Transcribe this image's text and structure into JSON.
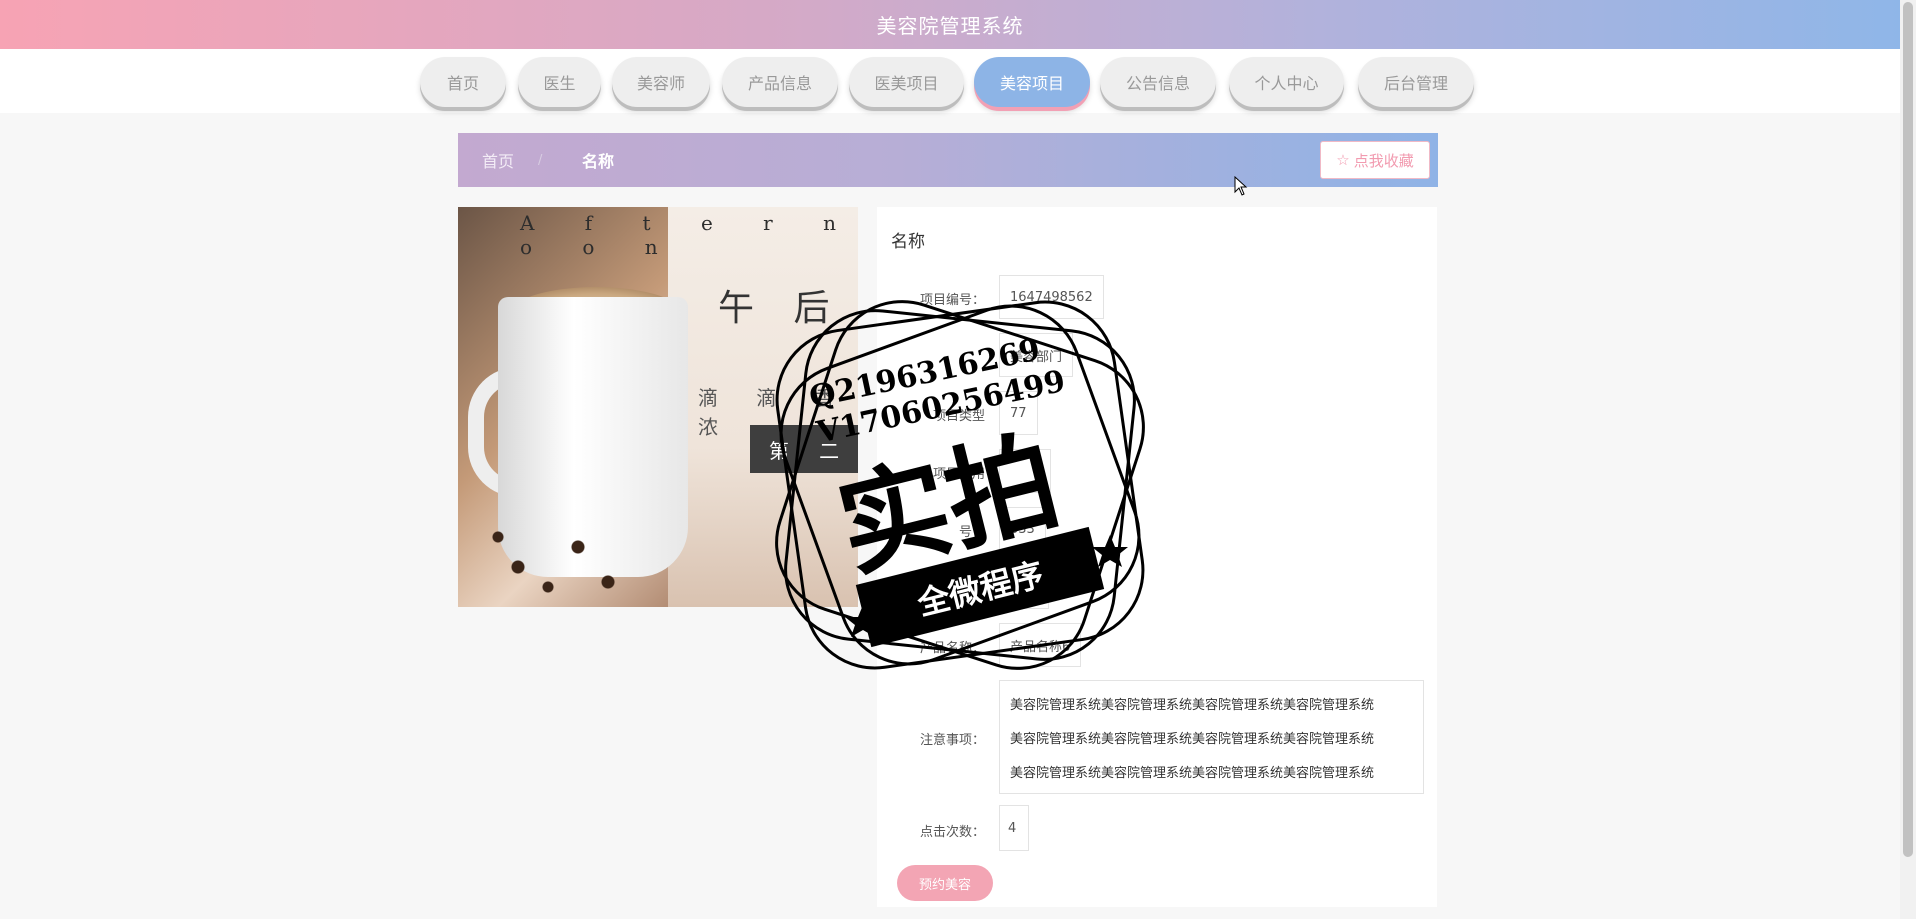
{
  "header": {
    "title": "美容院管理系统"
  },
  "nav": {
    "items": [
      {
        "label": "首页"
      },
      {
        "label": "医生"
      },
      {
        "label": "美容师"
      },
      {
        "label": "产品信息"
      },
      {
        "label": "医美项目"
      },
      {
        "label": "美容项目"
      },
      {
        "label": "公告信息"
      },
      {
        "label": "个人中心"
      },
      {
        "label": "后台管理"
      }
    ],
    "active": "美容项目"
  },
  "breadcrumb": {
    "home": "首页",
    "separator": "/",
    "current": "名称"
  },
  "favorite": {
    "icon": "star-outline-icon",
    "label": "点我收藏"
  },
  "image": {
    "text_line1": "A f t e r n o o n",
    "text_line2": "午 后",
    "text_line3": "滴 滴 香 浓",
    "text_line4": "第 二"
  },
  "detail": {
    "title": "名称",
    "fields": [
      {
        "label": "项目编号：",
        "value": "1647498562"
      },
      {
        "label": "",
        "value": "美容部门"
      },
      {
        "label": "项目类型",
        "value": "77"
      },
      {
        "label": "项目费用",
        "value": ""
      },
      {
        "label": "号：",
        "value": "333"
      },
      {
        "label": "",
        "value": ""
      },
      {
        "label": "产品名称：",
        "value": "产品名称6"
      }
    ],
    "notes_label": "注意事项：",
    "notes": [
      "美容院管理系统美容院管理系统美容院管理系统美容院管理系统",
      "美容院管理系统美容院管理系统美容院管理系统美容院管理系统",
      "美容院管理系统美容院管理系统美容院管理系统美容院管理系统"
    ],
    "clicks_label": "点击次数：",
    "clicks_value": "4",
    "book_button": "预约美容"
  },
  "watermark": {
    "qq": "Q2196316269",
    "v": "V17060256499",
    "big": "实拍",
    "banner": "全微程序"
  }
}
